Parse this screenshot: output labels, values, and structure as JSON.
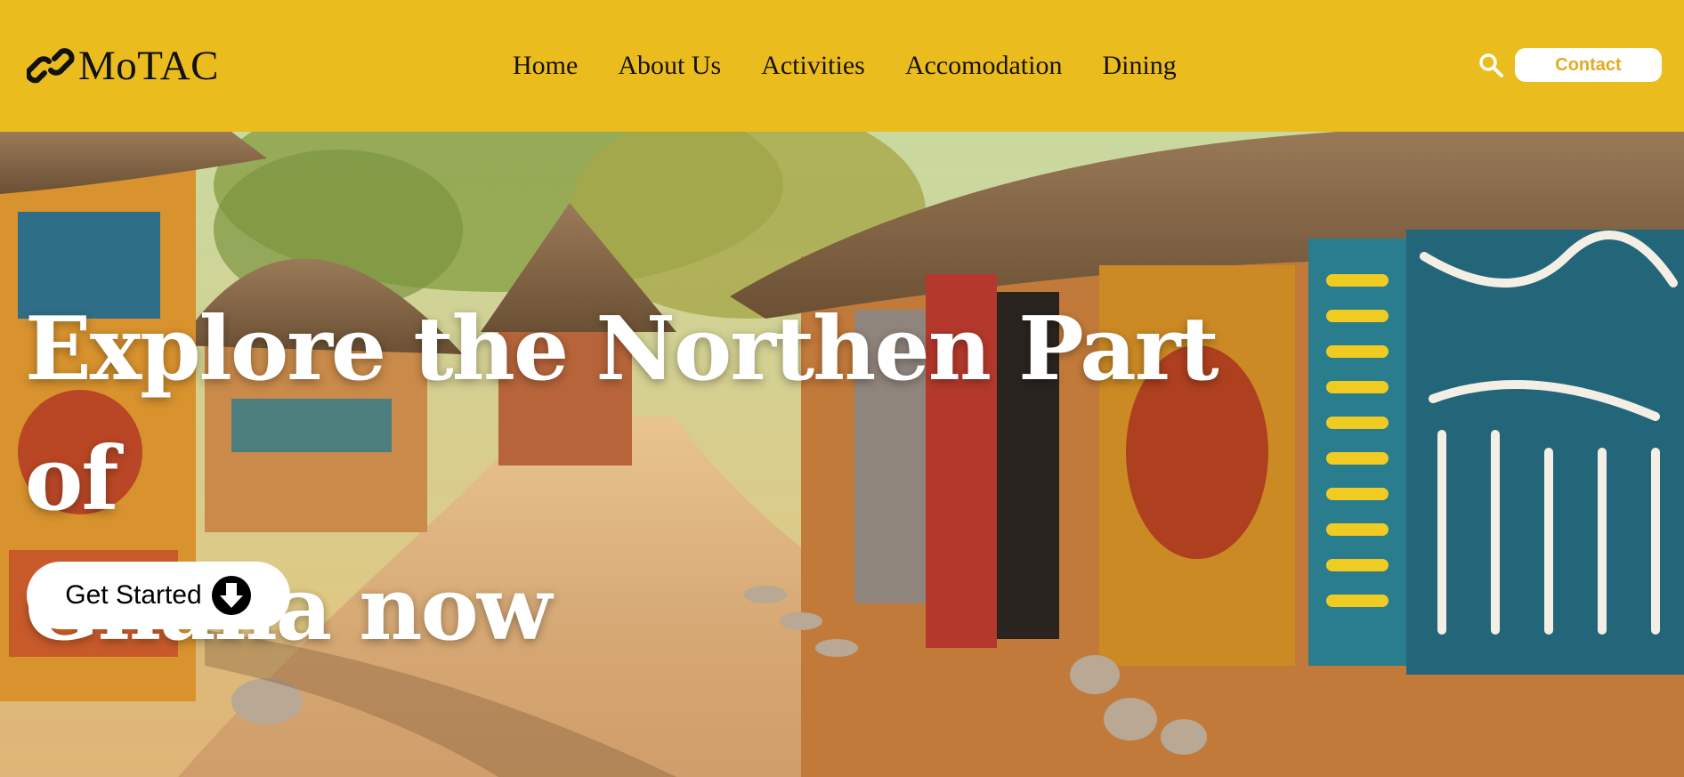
{
  "colors": {
    "header_bg": "#ebbc1e",
    "accent": "#e3a922",
    "text_dark": "#161208",
    "white": "#ffffff"
  },
  "brand": {
    "logo_text": "MoTAC",
    "logo_icon": "chain-link-icon"
  },
  "nav": {
    "items": [
      {
        "label": "Home"
      },
      {
        "label": "About Us"
      },
      {
        "label": "Activities"
      },
      {
        "label": "Accomodation"
      },
      {
        "label": "Dining"
      }
    ]
  },
  "header_actions": {
    "search_icon": "search-icon",
    "contact_label": "Contact"
  },
  "hero": {
    "title_line1": "Explore the Northen Part of",
    "title_line2": "Ghana now",
    "cta_label": "Get Started",
    "cta_icon": "arrow-down-circle-icon",
    "background": "painted-huts-village-image"
  }
}
